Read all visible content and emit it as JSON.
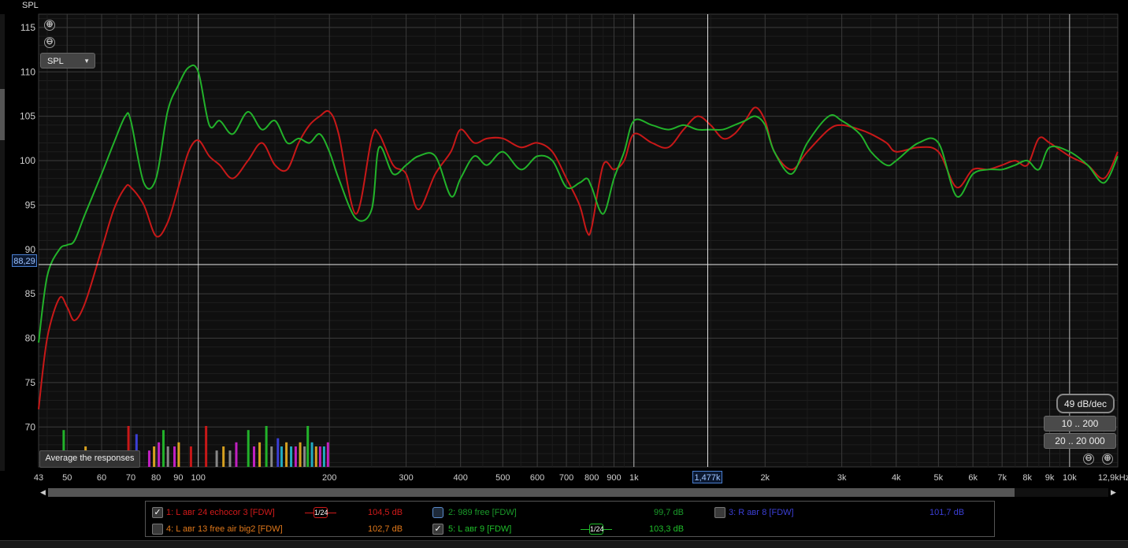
{
  "window": {
    "title": "SPL"
  },
  "controls": {
    "zoom_in": "⊕",
    "zoom_out": "⊖",
    "dropdown": {
      "selected": "SPL"
    },
    "average_button": "Average the responses",
    "slope_label": "49 dB/dec",
    "range_btn_1": "10 .. 200",
    "range_btn_2": "20 .. 20 000",
    "cursor_y_value": "88,29",
    "cursor_x_value": "1,477k"
  },
  "legend": {
    "items": [
      {
        "label": "1: L авг 24 echocor 3 [FDW]",
        "value": "104,5 dB",
        "checked": true,
        "color": "#d01a1a",
        "smoothing": "1/24"
      },
      {
        "label": "2: 989 free [FDW]",
        "value": "99,7 dB",
        "checked": false,
        "color": "#1a9a2a"
      },
      {
        "label": "3: R авг 8 [FDW]",
        "value": "101,7 dB",
        "checked": false,
        "color": "#3b3fd6"
      },
      {
        "label": "4: L авг 13 free air big2 [FDW]",
        "value": "102,7 dB",
        "checked": false,
        "color": "#e0781a"
      },
      {
        "label": "5: L авг 9 [FDW]",
        "value": "103,3 dB",
        "checked": true,
        "color": "#1fbf2a",
        "smoothing": "1/24"
      }
    ]
  },
  "chart_data": {
    "type": "line",
    "ylabel": "SPL",
    "xscale": "log",
    "xlim": [
      43,
      12900
    ],
    "ylim": [
      65.5,
      116.5
    ],
    "y_ticks": [
      70,
      75,
      80,
      85,
      90,
      95,
      100,
      105,
      110,
      115
    ],
    "x_ticks": [
      {
        "v": 43,
        "t": "43"
      },
      {
        "v": 50,
        "t": "50"
      },
      {
        "v": 60,
        "t": "60"
      },
      {
        "v": 70,
        "t": "70"
      },
      {
        "v": 80,
        "t": "80"
      },
      {
        "v": 90,
        "t": "90"
      },
      {
        "v": 100,
        "t": "100"
      },
      {
        "v": 200,
        "t": "200"
      },
      {
        "v": 300,
        "t": "300"
      },
      {
        "v": 400,
        "t": "400"
      },
      {
        "v": 500,
        "t": "500"
      },
      {
        "v": 600,
        "t": "600"
      },
      {
        "v": 700,
        "t": "700"
      },
      {
        "v": 800,
        "t": "800"
      },
      {
        "v": 900,
        "t": "900"
      },
      {
        "v": 1000,
        "t": "1k"
      },
      {
        "v": 2000,
        "t": "2k"
      },
      {
        "v": 3000,
        "t": "3k"
      },
      {
        "v": 4000,
        "t": "4k"
      },
      {
        "v": 5000,
        "t": "5k"
      },
      {
        "v": 6000,
        "t": "6k"
      },
      {
        "v": 7000,
        "t": "7k"
      },
      {
        "v": 8000,
        "t": "8k"
      },
      {
        "v": 9000,
        "t": "9k"
      },
      {
        "v": 10000,
        "t": "10k"
      },
      {
        "v": 12900,
        "t": "12,9kHz"
      }
    ],
    "cursor": {
      "x": 1477,
      "y": 88.29
    },
    "series": [
      {
        "color": "#c81818",
        "x": [
          43,
          45,
          48,
          50,
          52,
          55,
          60,
          64,
          68,
          70,
          75,
          80,
          85,
          90,
          95,
          100,
          106,
          112,
          120,
          130,
          140,
          150,
          160,
          170,
          180,
          190,
          200,
          210,
          230,
          250,
          260,
          280,
          300,
          320,
          350,
          380,
          400,
          430,
          460,
          500,
          550,
          600,
          650,
          700,
          750,
          780,
          800,
          850,
          900,
          950,
          1000,
          1100,
          1200,
          1300,
          1400,
          1500,
          1600,
          1700,
          1800,
          1900,
          2000,
          2100,
          2300,
          2500,
          2800,
          3000,
          3300,
          3500,
          3800,
          4000,
          4500,
          5000,
          5500,
          6000,
          6500,
          7000,
          7500,
          8000,
          8500,
          9000,
          10000,
          11000,
          12000,
          12900
        ],
        "y": [
          72,
          80,
          84.5,
          83.5,
          82,
          84,
          90,
          94.5,
          97,
          97,
          95,
          91.5,
          93,
          97,
          101,
          102.3,
          100.5,
          99.5,
          98,
          100,
          102,
          99.5,
          99,
          102,
          104,
          105,
          105.5,
          103,
          94,
          102.5,
          103,
          99.5,
          98.5,
          94.5,
          98.5,
          101,
          103.5,
          102,
          102.5,
          102.5,
          101.5,
          102,
          101,
          98,
          95,
          92,
          92.5,
          99.5,
          99,
          100,
          103,
          102,
          101.5,
          103.5,
          105,
          104,
          102.5,
          103,
          104.5,
          106,
          104.5,
          101,
          99,
          101,
          103.5,
          104,
          103.5,
          103,
          102,
          101,
          101.5,
          101,
          97,
          99,
          99,
          99.5,
          100,
          99.5,
          102.5,
          102,
          100.5,
          99.5,
          98,
          101
        ]
      },
      {
        "color": "#22b22a",
        "x": [
          43,
          45,
          48,
          50,
          52,
          55,
          60,
          64,
          68,
          70,
          75,
          80,
          85,
          90,
          95,
          100,
          106,
          112,
          120,
          130,
          140,
          150,
          160,
          170,
          180,
          190,
          200,
          210,
          230,
          250,
          260,
          280,
          300,
          320,
          350,
          380,
          400,
          430,
          460,
          500,
          550,
          600,
          650,
          700,
          750,
          780,
          800,
          850,
          900,
          950,
          1000,
          1100,
          1200,
          1300,
          1400,
          1500,
          1600,
          1700,
          1800,
          1900,
          2000,
          2100,
          2300,
          2500,
          2800,
          3000,
          3300,
          3500,
          3800,
          4000,
          4500,
          5000,
          5500,
          6000,
          6500,
          7000,
          7500,
          8000,
          8500,
          9000,
          10000,
          11000,
          12000,
          12900
        ],
        "y": [
          79.5,
          87,
          90,
          90.5,
          91,
          94,
          98.5,
          102,
          105,
          104.5,
          97.5,
          98,
          105.5,
          108.5,
          110.5,
          110,
          104,
          104.5,
          103,
          105.5,
          103.5,
          104.5,
          102,
          102.5,
          102,
          103,
          101,
          98,
          93.5,
          94.5,
          101.5,
          98.5,
          99.5,
          100.5,
          100.5,
          96,
          98,
          100.5,
          99.5,
          101,
          99,
          100.5,
          100,
          97,
          97.5,
          98,
          97,
          94,
          98,
          101,
          104.5,
          104,
          103.5,
          104,
          103.5,
          103.5,
          103.5,
          104,
          104.5,
          105,
          104,
          101,
          98.5,
          102,
          105,
          104.5,
          103,
          101,
          99.5,
          100,
          102,
          102,
          96,
          98.5,
          99,
          99,
          99.5,
          100,
          99,
          101.5,
          101,
          99.5,
          97.5,
          100.5
        ]
      }
    ],
    "impulse_bars": [
      {
        "x": 49,
        "h": 0.9,
        "c": "#22b22a"
      },
      {
        "x": 55,
        "h": 0.5,
        "c": "#d6a020"
      },
      {
        "x": 69,
        "h": 1.0,
        "c": "#c81818"
      },
      {
        "x": 72,
        "h": 0.8,
        "c": "#3b3fd6"
      },
      {
        "x": 77,
        "h": 0.4,
        "c": "#c020c0"
      },
      {
        "x": 79,
        "h": 0.5,
        "c": "#d6a020"
      },
      {
        "x": 81,
        "h": 0.6,
        "c": "#c020c0"
      },
      {
        "x": 83,
        "h": 0.9,
        "c": "#22b22a"
      },
      {
        "x": 85,
        "h": 0.5,
        "c": "#888888"
      },
      {
        "x": 88,
        "h": 0.5,
        "c": "#c020c0"
      },
      {
        "x": 90,
        "h": 0.6,
        "c": "#d6a020"
      },
      {
        "x": 96,
        "h": 0.5,
        "c": "#c81818"
      },
      {
        "x": 104,
        "h": 1.0,
        "c": "#c81818"
      },
      {
        "x": 110,
        "h": 0.4,
        "c": "#888888"
      },
      {
        "x": 114,
        "h": 0.5,
        "c": "#d6a020"
      },
      {
        "x": 118,
        "h": 0.4,
        "c": "#888888"
      },
      {
        "x": 122,
        "h": 0.6,
        "c": "#c020c0"
      },
      {
        "x": 130,
        "h": 0.9,
        "c": "#22b22a"
      },
      {
        "x": 134,
        "h": 0.5,
        "c": "#c020c0"
      },
      {
        "x": 138,
        "h": 0.6,
        "c": "#d6a020"
      },
      {
        "x": 143,
        "h": 1.0,
        "c": "#22b22a"
      },
      {
        "x": 147,
        "h": 0.5,
        "c": "#888888"
      },
      {
        "x": 152,
        "h": 0.7,
        "c": "#3b3fd6"
      },
      {
        "x": 155,
        "h": 0.5,
        "c": "#22aac0"
      },
      {
        "x": 159,
        "h": 0.6,
        "c": "#d6a020"
      },
      {
        "x": 163,
        "h": 0.5,
        "c": "#22aac0"
      },
      {
        "x": 167,
        "h": 0.5,
        "c": "#c020c0"
      },
      {
        "x": 171,
        "h": 0.6,
        "c": "#d6a020"
      },
      {
        "x": 175,
        "h": 0.5,
        "c": "#888888"
      },
      {
        "x": 178,
        "h": 1.0,
        "c": "#22b22a"
      },
      {
        "x": 182,
        "h": 0.6,
        "c": "#22aac0"
      },
      {
        "x": 186,
        "h": 0.5,
        "c": "#d6a020"
      },
      {
        "x": 190,
        "h": 0.5,
        "c": "#c020c0"
      },
      {
        "x": 194,
        "h": 0.5,
        "c": "#22aac0"
      },
      {
        "x": 198,
        "h": 0.6,
        "c": "#c020c0"
      }
    ]
  }
}
